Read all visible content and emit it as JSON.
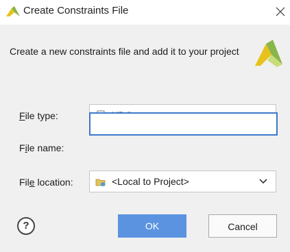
{
  "window": {
    "title": "Create Constraints File",
    "close_icon": "close-icon",
    "logo_icon": "vivado-logo-icon"
  },
  "description": "Create a new constraints file and add it to your project",
  "form": {
    "file_type": {
      "label_prefix": "",
      "label_mnemonic": "F",
      "label_rest": "ile type:",
      "value": "XDC",
      "icon": "xdc-file-icon"
    },
    "file_name": {
      "label_prefix": "F",
      "label_mnemonic": "i",
      "label_rest": "le name:",
      "value": "",
      "placeholder": ""
    },
    "file_location": {
      "label_prefix": "Fil",
      "label_mnemonic": "e",
      "label_rest": " location:",
      "value": "<Local to Project>",
      "icon": "folder-icon"
    }
  },
  "buttons": {
    "help": "?",
    "ok": "OK",
    "cancel": "Cancel"
  },
  "colors": {
    "accent": "#5b93e0",
    "focus_border": "#3c78c8",
    "logo_yellow": "#e8c21c",
    "logo_green": "#8ab54a"
  }
}
